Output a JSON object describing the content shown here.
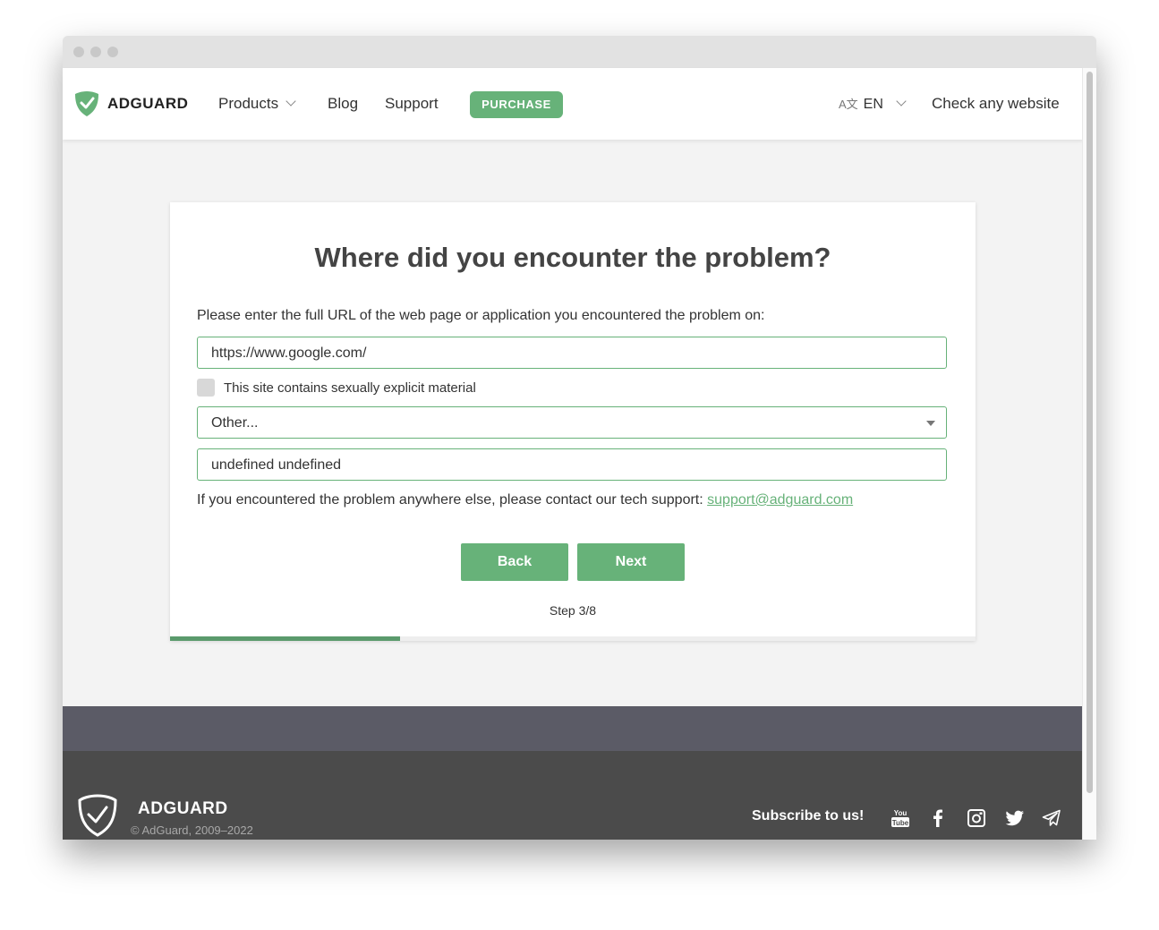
{
  "header": {
    "logo_text": "ADGUARD",
    "nav": {
      "products": "Products",
      "blog": "Blog",
      "support": "Support"
    },
    "purchase_label": "PURCHASE",
    "language": "EN",
    "check_website": "Check any website"
  },
  "form": {
    "title": "Where did you encounter the problem?",
    "prompt": "Please enter the full URL of the web page or application you encountered the problem on:",
    "url_value": "https://www.google.com/",
    "explicit_checkbox_label": "This site contains sexually explicit material",
    "explicit_checked": false,
    "category_selected": "Other...",
    "app_value": "undefined undefined",
    "support_text": "If you encountered the problem anywhere else, please contact our tech support:",
    "support_email": "support@adguard.com",
    "back_label": "Back",
    "next_label": "Next",
    "step_label": "Step 3/8",
    "progress": 0.2857
  },
  "footer": {
    "logo_text": "ADGUARD",
    "copyright": "© AdGuard, 2009–2022",
    "subscribe_label": "Subscribe to us!",
    "social_icons": [
      "youtube-icon",
      "facebook-icon",
      "instagram-icon",
      "twitter-icon",
      "telegram-icon"
    ]
  },
  "colors": {
    "accent": "#67b279",
    "progress_fill": "#5a9a6c",
    "footer_band": "#5b5b66",
    "footer_bg": "#4b4b4b"
  }
}
